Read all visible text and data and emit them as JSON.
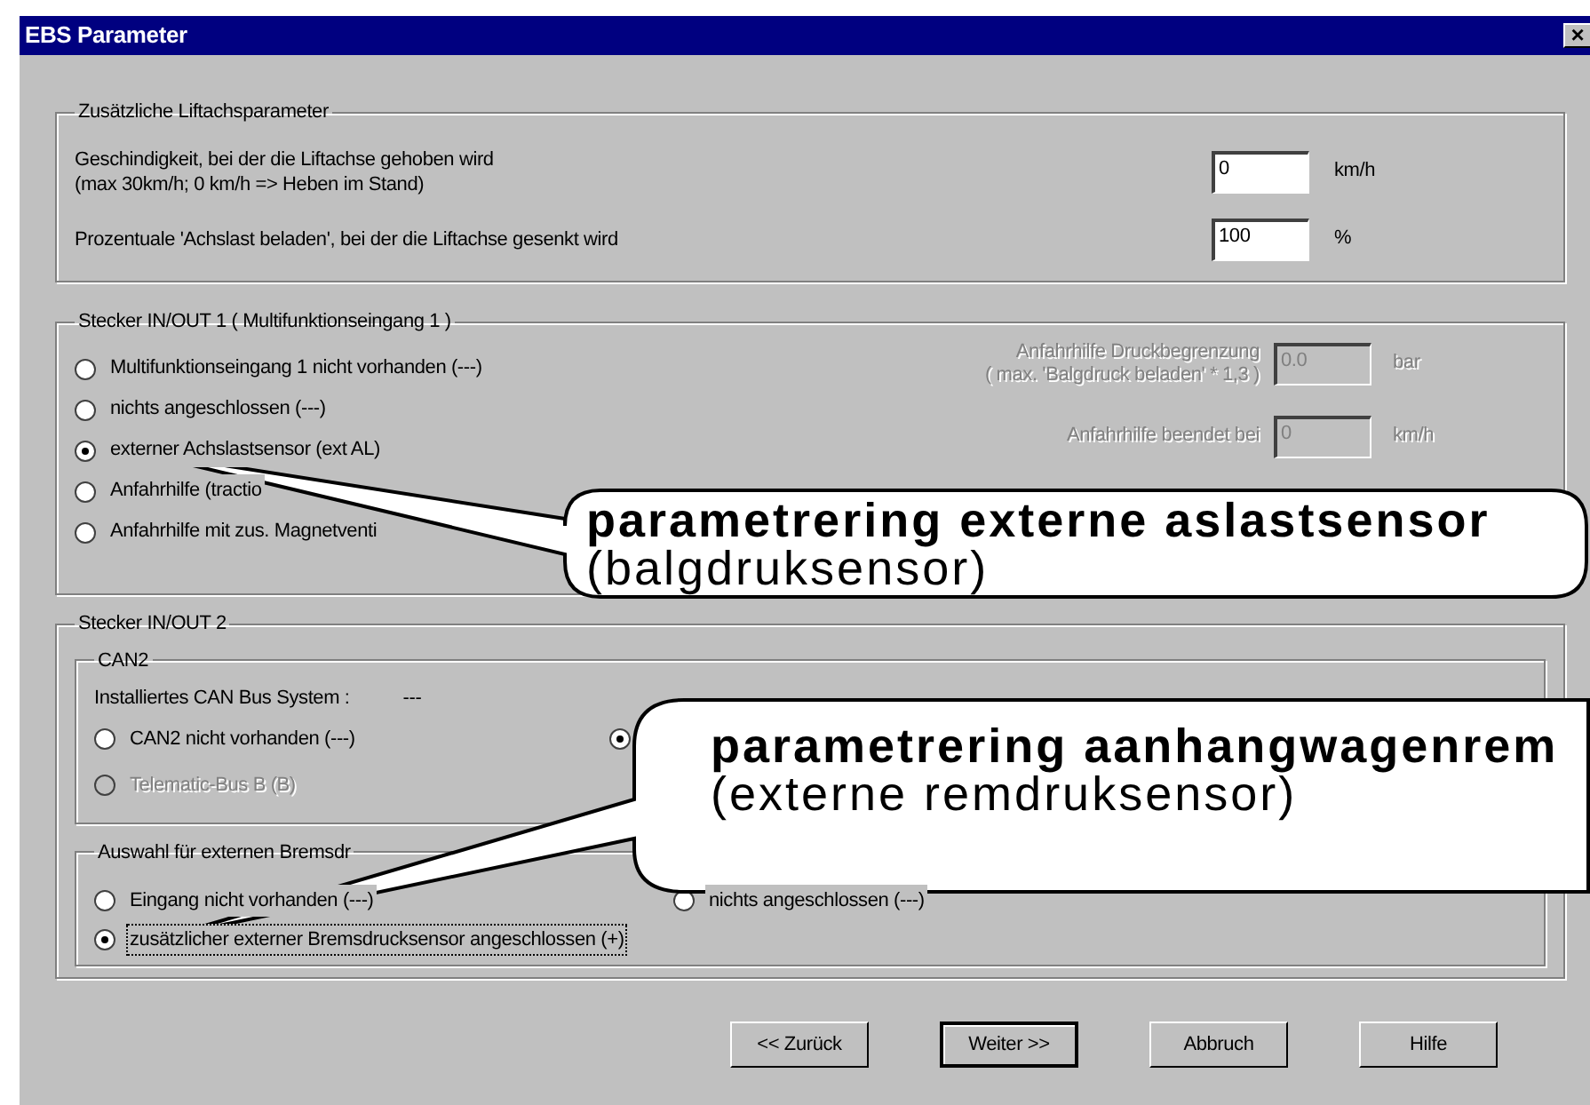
{
  "window": {
    "title": "EBS Parameter",
    "close": "×"
  },
  "lift_group": {
    "legend": "Zusätzliche Liftachsparameter",
    "rows": [
      {
        "lines": [
          "Geschindigkeit, bei der die Liftachse gehoben wird",
          "(max 30km/h; 0 km/h => Heben im Stand)"
        ],
        "value": "0",
        "unit": "km/h"
      },
      {
        "lines": [
          "Prozentuale 'Achslast beladen', bei der die Liftachse gesenkt wird"
        ],
        "value": "100",
        "unit": "%"
      }
    ]
  },
  "io1": {
    "legend": "Stecker IN/OUT 1 ( Multifunktionseingang 1 )",
    "options": [
      {
        "label": "Multifunktionseingang 1 nicht vorhanden (---)",
        "selected": false
      },
      {
        "label": "nichts angeschlossen (---)",
        "selected": false
      },
      {
        "label": "externer Achslastsensor (ext AL)",
        "selected": true
      },
      {
        "label": "Anfahrhilfe (tractio",
        "selected": false
      },
      {
        "label": "Anfahrhilfe mit zus. Magnetventi",
        "selected": false
      }
    ],
    "settings": [
      {
        "lines": [
          "Anfahrhilfe Druckbegrenzung",
          "( max. 'Balgdruck beladen' * 1,3 )"
        ],
        "value": "0.0",
        "unit": "bar",
        "disabled": true
      },
      {
        "lines": [
          "Anfahrhilfe beendet bei"
        ],
        "value": "0",
        "unit": "km/h",
        "disabled": true
      }
    ]
  },
  "io2": {
    "legend": "Stecker IN/OUT 2",
    "can2": {
      "legend": "CAN2",
      "bus_label": "Installiertes CAN Bus System :",
      "bus_value": "---",
      "options": [
        {
          "label": "CAN2 nicht vorhanden (---)",
          "selected": false,
          "disabled": false
        },
        {
          "selected": true,
          "disabled": false
        },
        {
          "label": "Telematic-Bus B (B)",
          "selected": false,
          "disabled": true
        }
      ]
    },
    "brake": {
      "legend": "Auswahl für externen Bremsdr",
      "options": [
        {
          "label": "Eingang nicht vorhanden (---)",
          "selected": false,
          "focused": false
        },
        {
          "label": "nichts angeschlossen (---)",
          "selected": false,
          "focused": false
        },
        {
          "label": "zusätzlicher externer Bremsdrucksensor angeschlossen (+)",
          "selected": true,
          "focused": true
        }
      ]
    }
  },
  "buttons": [
    {
      "label": "<< Zurück",
      "default": false
    },
    {
      "label": "Weiter >>",
      "default": true
    },
    {
      "label": "Abbruch",
      "default": false
    },
    {
      "label": "Hilfe",
      "default": false
    }
  ],
  "callouts": [
    {
      "title": "parametrering externe aslastsensor",
      "subtitle": "(balgdruksensor)"
    },
    {
      "title": "parametrering aanhangwagenrem",
      "subtitle": "(externe remdruksensor)"
    }
  ]
}
